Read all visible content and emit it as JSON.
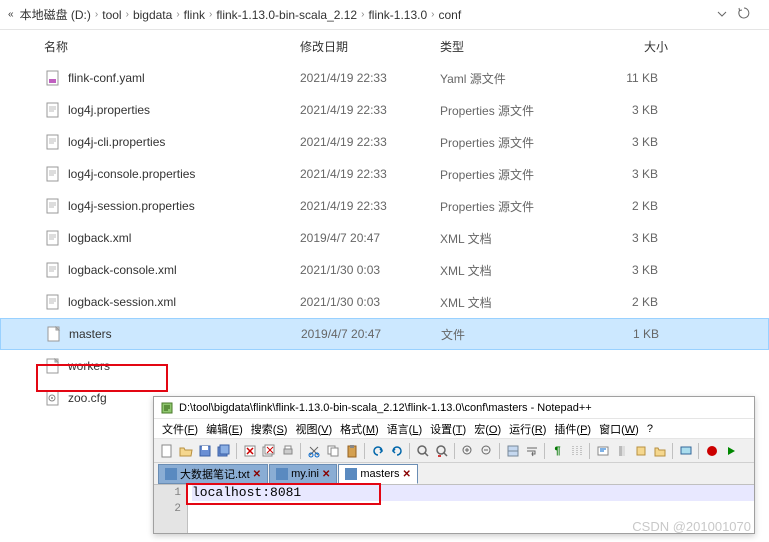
{
  "breadcrumb": {
    "prefix": "«",
    "items": [
      "本地磁盘 (D:)",
      "tool",
      "bigdata",
      "flink",
      "flink-1.13.0-bin-scala_2.12",
      "flink-1.13.0",
      "conf"
    ]
  },
  "columns": {
    "name": "名称",
    "date": "修改日期",
    "type": "类型",
    "size": "大小"
  },
  "files": [
    {
      "icon": "yaml",
      "name": "flink-conf.yaml",
      "date": "2021/4/19 22:33",
      "type": "Yaml 源文件",
      "size": "11 KB",
      "interact": true
    },
    {
      "icon": "file",
      "name": "log4j.properties",
      "date": "2021/4/19 22:33",
      "type": "Properties 源文件",
      "size": "3 KB",
      "interact": true
    },
    {
      "icon": "file",
      "name": "log4j-cli.properties",
      "date": "2021/4/19 22:33",
      "type": "Properties 源文件",
      "size": "3 KB",
      "interact": true
    },
    {
      "icon": "file",
      "name": "log4j-console.properties",
      "date": "2021/4/19 22:33",
      "type": "Properties 源文件",
      "size": "3 KB",
      "interact": true
    },
    {
      "icon": "file",
      "name": "log4j-session.properties",
      "date": "2021/4/19 22:33",
      "type": "Properties 源文件",
      "size": "2 KB",
      "interact": true
    },
    {
      "icon": "file",
      "name": "logback.xml",
      "date": "2019/4/7 20:47",
      "type": "XML 文档",
      "size": "3 KB",
      "interact": true
    },
    {
      "icon": "file",
      "name": "logback-console.xml",
      "date": "2021/1/30 0:03",
      "type": "XML 文档",
      "size": "3 KB",
      "interact": true
    },
    {
      "icon": "file",
      "name": "logback-session.xml",
      "date": "2021/1/30 0:03",
      "type": "XML 文档",
      "size": "2 KB",
      "interact": true
    },
    {
      "icon": "blank",
      "name": "masters",
      "date": "2019/4/7 20:47",
      "type": "文件",
      "size": "1 KB",
      "selected": true,
      "interact": true
    },
    {
      "icon": "blank",
      "name": "workers",
      "date": "",
      "type": "",
      "size": "",
      "interact": true
    },
    {
      "icon": "cfg",
      "name": "zoo.cfg",
      "date": "",
      "type": "",
      "size": "",
      "interact": true
    }
  ],
  "notepad": {
    "title": "D:\\tool\\bigdata\\flink\\flink-1.13.0-bin-scala_2.12\\flink-1.13.0\\conf\\masters - Notepad++",
    "menu": [
      "文件(F)",
      "编辑(E)",
      "搜索(S)",
      "视图(V)",
      "格式(M)",
      "语言(L)",
      "设置(T)",
      "宏(O)",
      "运行(R)",
      "插件(P)",
      "窗口(W)",
      "?"
    ],
    "tabs": [
      {
        "label": "大数据笔记.txt",
        "active": false
      },
      {
        "label": "my.ini",
        "active": false
      },
      {
        "label": "masters",
        "active": true
      }
    ],
    "lines": [
      "localhost:8081",
      ""
    ],
    "line_numbers": [
      "1",
      "2"
    ]
  },
  "watermark": "CSDN @201001070"
}
